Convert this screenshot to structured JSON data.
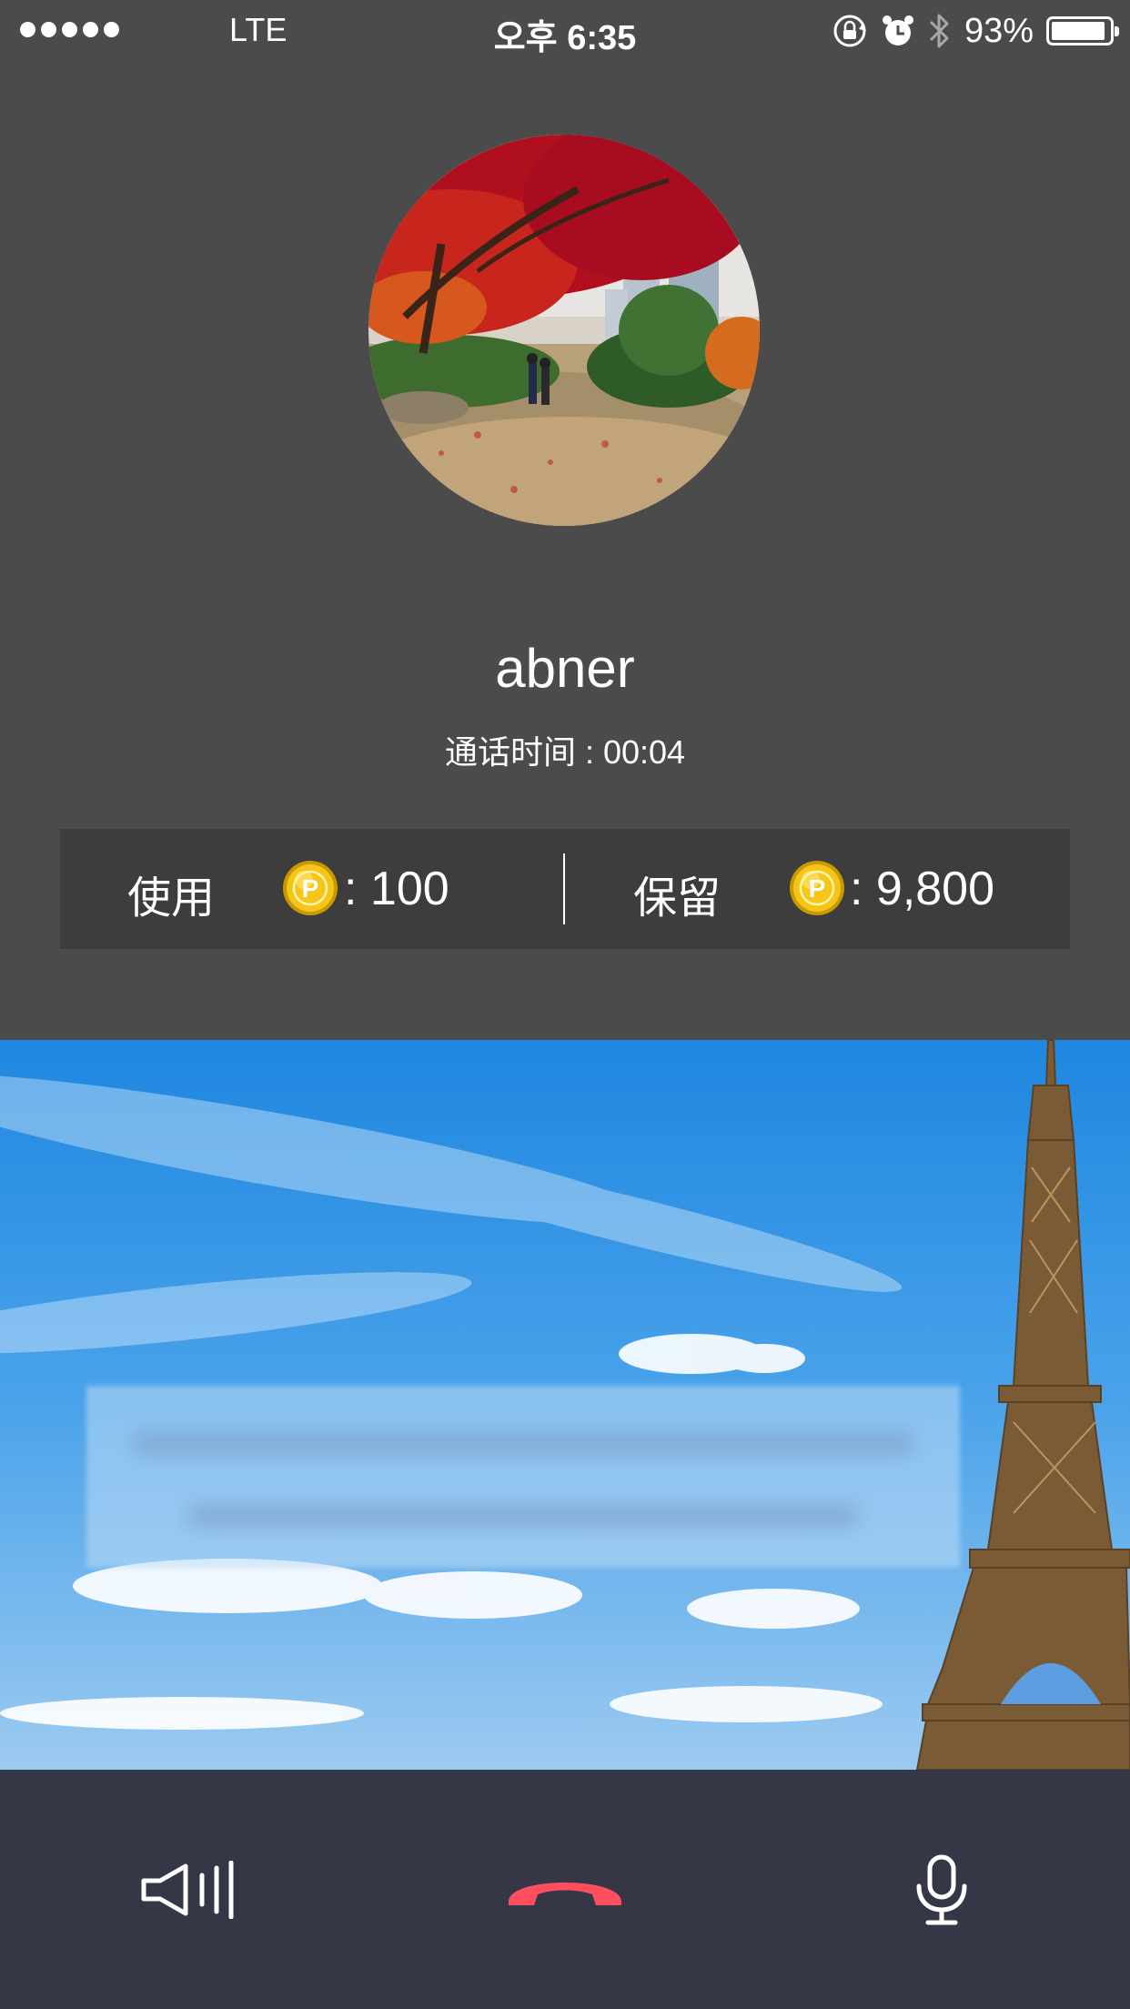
{
  "status_bar": {
    "carrier": "LTE",
    "time": "오후 6:35",
    "battery_percent": "93%",
    "battery_level": 0.93,
    "icons": [
      "signal-dots-icon",
      "rotation-lock-icon",
      "alarm-icon",
      "bluetooth-icon",
      "battery-icon"
    ]
  },
  "caller": {
    "name": "abner",
    "duration_label": "通话时间",
    "duration_separator": ":",
    "duration_value": "00:04"
  },
  "points": {
    "used_label": "使用",
    "used_value": ": 100",
    "reserved_label": "保留",
    "reserved_value": ": 9,800",
    "coin_letter": "P"
  },
  "controls": {
    "icons": [
      "speaker-icon",
      "hang-up-icon",
      "microphone-icon"
    ]
  },
  "colors": {
    "background": "#4b4b4b",
    "points_bar": "#3d3d3d",
    "controls_bar": "#353746",
    "hang_up": "#ff4f5e",
    "coin": "#f2c200"
  }
}
